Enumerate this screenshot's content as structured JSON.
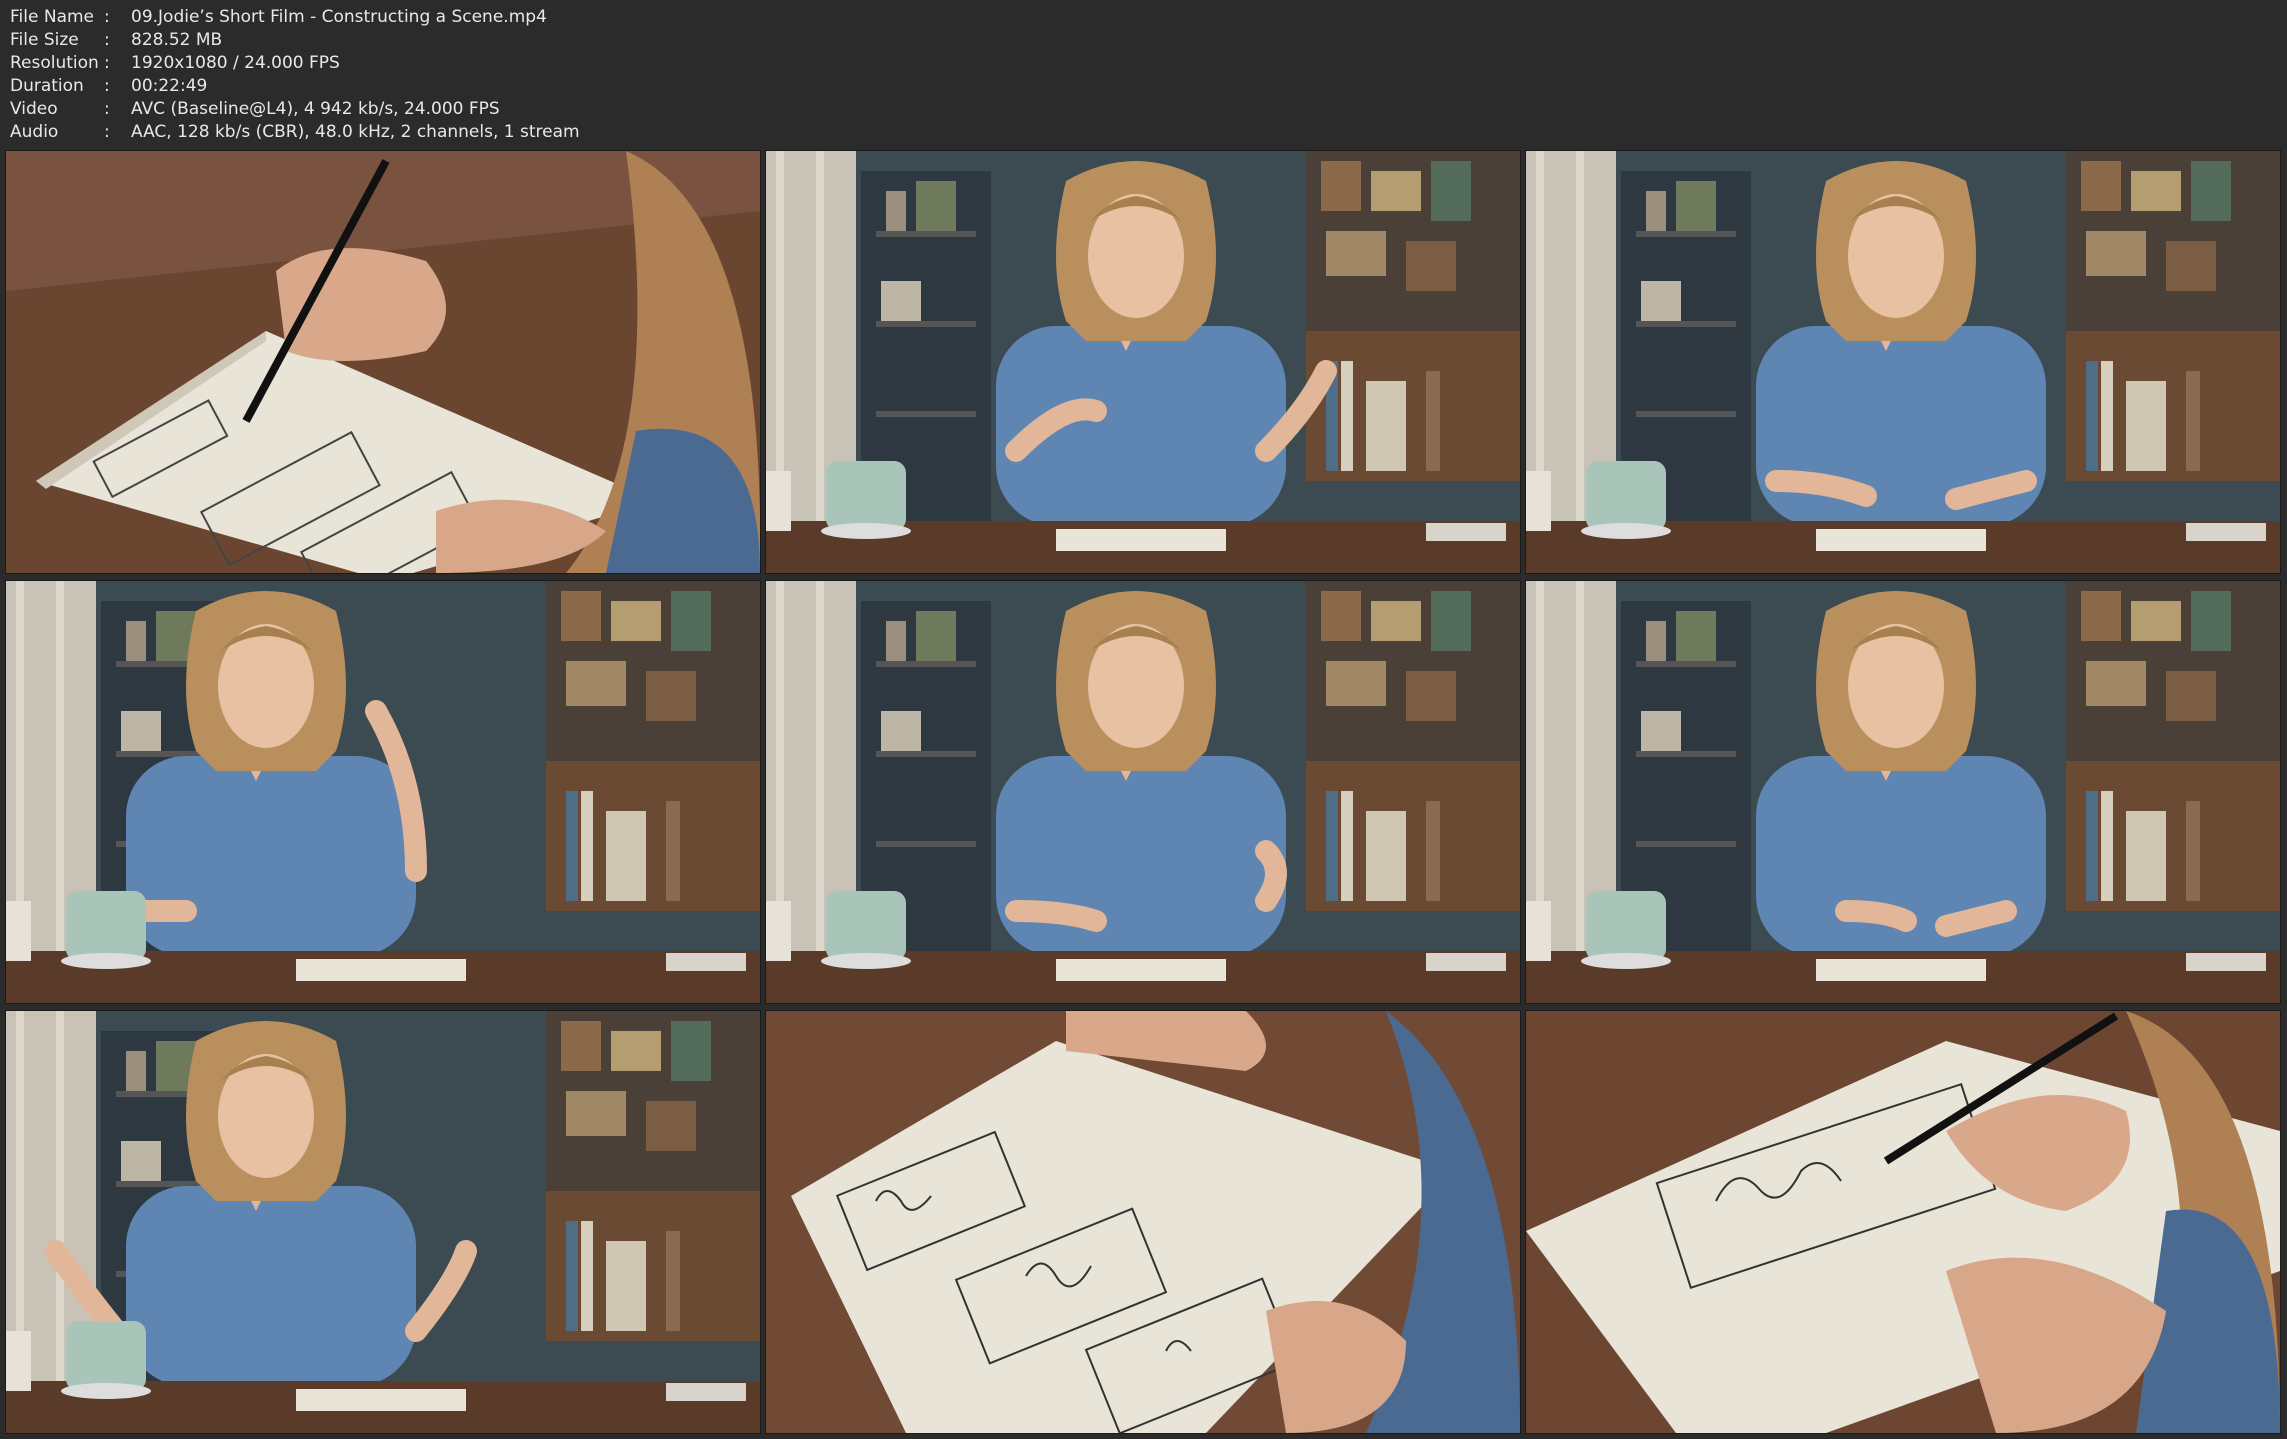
{
  "info": {
    "rows": [
      {
        "key": "File Name",
        "value": "09.Jodie’s Short Film - Constructing a Scene.mp4"
      },
      {
        "key": "File Size",
        "value": "828.52 MB"
      },
      {
        "key": "Resolution",
        "value": "1920x1080 / 24.000 FPS"
      },
      {
        "key": "Duration",
        "value": "00:22:49"
      },
      {
        "key": "Video",
        "value": "AVC (Baseline@L4), 4 942 kb/s, 24.000 FPS"
      },
      {
        "key": "Audio",
        "value": "AAC, 128 kb/s (CBR), 48.0 kHz, 2 channels, 1 stream"
      }
    ],
    "separator": ":"
  },
  "thumbnails": [
    {
      "kind": "drawing-closeup",
      "description": "Hand sketching storyboard panels on paper"
    },
    {
      "kind": "speaker",
      "pose": "gesturing"
    },
    {
      "kind": "speaker",
      "pose": "eyes-down"
    },
    {
      "kind": "speaker",
      "pose": "pointing-up"
    },
    {
      "kind": "speaker",
      "pose": "talking"
    },
    {
      "kind": "speaker",
      "pose": "writing"
    },
    {
      "kind": "speaker",
      "pose": "both-hands"
    },
    {
      "kind": "drawing-overhead",
      "description": "Storyboard with three sketched panels"
    },
    {
      "kind": "drawing-closeup2",
      "description": "Pen drawing a single large panel"
    }
  ],
  "colors": {
    "background": "#2b2b2b",
    "text": "#e8e8e8",
    "desk": "#5a3a28",
    "shirt": "#5f86b3",
    "wall": "#3c4a52",
    "paper": "#e9e4d8"
  }
}
